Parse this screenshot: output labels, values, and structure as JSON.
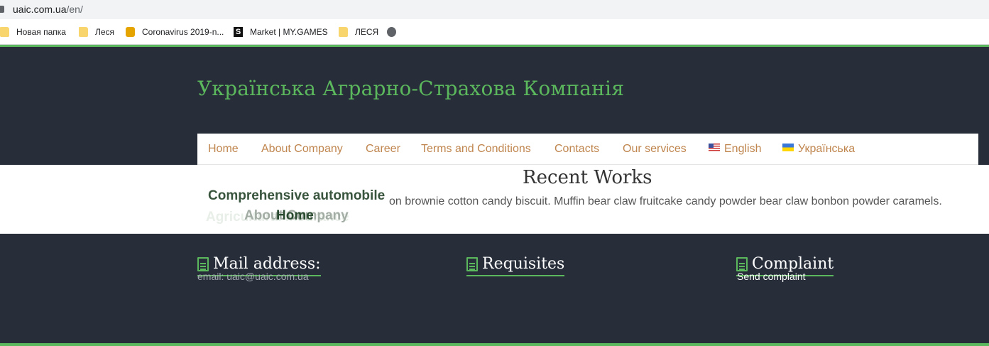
{
  "browser": {
    "url_host": "uaic.com.ua",
    "url_path": "/en/",
    "bookmarks": [
      {
        "label": "Новая папка",
        "icon": "folder-icon"
      },
      {
        "label": "Леся",
        "icon": "folder-icon"
      },
      {
        "label": "Coronavirus 2019-n...",
        "icon": "coronavirus-site-icon"
      },
      {
        "label": "Market | MY.GAMES",
        "icon": "mygames-icon"
      },
      {
        "label": "ЛЕСЯ",
        "icon": "folder-icon"
      },
      {
        "label": "",
        "icon": "globe-icon"
      }
    ]
  },
  "header": {
    "site_title": "Українська Аграрно-Страхова Компанія"
  },
  "nav": {
    "items": [
      {
        "label": "Home"
      },
      {
        "label": "About Company"
      },
      {
        "label": "Career"
      },
      {
        "label": "Terms and Conditions"
      },
      {
        "label": "Contacts"
      },
      {
        "label": "Our services"
      },
      {
        "label": "English",
        "icon": "us-flag-icon"
      },
      {
        "label": "Українська",
        "icon": "ukraine-flag-icon"
      }
    ]
  },
  "main": {
    "section_title": "Recent Works",
    "body_text": "on brownie cotton candy biscuit. Muffin bear claw fruitcake candy powder bear claw bonbon powder caramels.",
    "slide_title": "Comprehensive automobile",
    "ghost_text": "Agricultural Insurance",
    "about_ghost": "About Company",
    "home_overlay": "Home"
  },
  "footer": {
    "mail": {
      "heading": "Mail address:",
      "text": "email: uaic@uaic.com.ua"
    },
    "requisites": {
      "heading": "Requisites"
    },
    "complaint": {
      "heading": "Complaint",
      "link": "Send complaint"
    }
  },
  "colors": {
    "accent": "#5cb85c",
    "dark_bg": "#272e3a",
    "nav_link": "#c0864f"
  }
}
